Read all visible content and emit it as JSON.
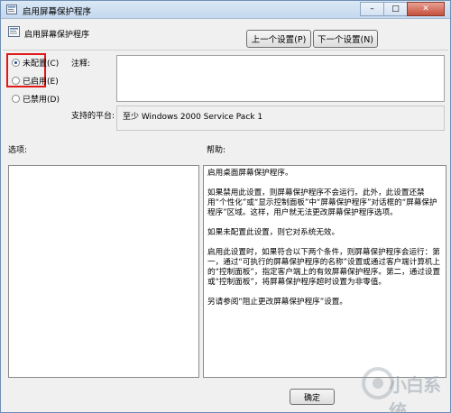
{
  "window": {
    "title": "启用屏幕保护程序",
    "controls": {
      "minimize": "–",
      "maximize": "□",
      "close": "✕"
    }
  },
  "header": {
    "setting_name": "启用屏幕保护程序",
    "prev_button": "上一个设置(P)",
    "next_button": "下一个设置(N)"
  },
  "state_options": [
    {
      "label": "未配置(C)",
      "checked": true
    },
    {
      "label": "已启用(E)",
      "checked": false
    },
    {
      "label": "已禁用(D)",
      "checked": false
    }
  ],
  "comment": {
    "label": "注释:",
    "value": ""
  },
  "supported": {
    "label": "支持的平台:",
    "value": "至少 Windows 2000 Service Pack 1"
  },
  "options": {
    "label": "选项:"
  },
  "help": {
    "label": "帮助:",
    "paragraphs": [
      "启用桌面屏幕保护程序。",
      "如果禁用此设置，则屏幕保护程序不会运行。此外，此设置还禁用“个性化”或“显示控制面板”中“屏幕保护程序”对话框的“屏幕保护程序”区域。这样，用户就无法更改屏幕保护程序选项。",
      "如果未配置此设置，则它对系统无效。",
      "启用此设置时，如果符合以下两个条件，则屏幕保护程序会运行：第一，通过“可执行的屏幕保护程序的名称”设置或通过客户端计算机上的“控制面板”，指定客户端上的有效屏幕保护程序。第二，通过设置或“控制面板”，将屏幕保护程序超时设置为非零值。",
      "另请参阅“阻止更改屏幕保护程序”设置。"
    ]
  },
  "footer": {
    "ok_button": "确定"
  },
  "watermark": {
    "text": "小白系统"
  }
}
